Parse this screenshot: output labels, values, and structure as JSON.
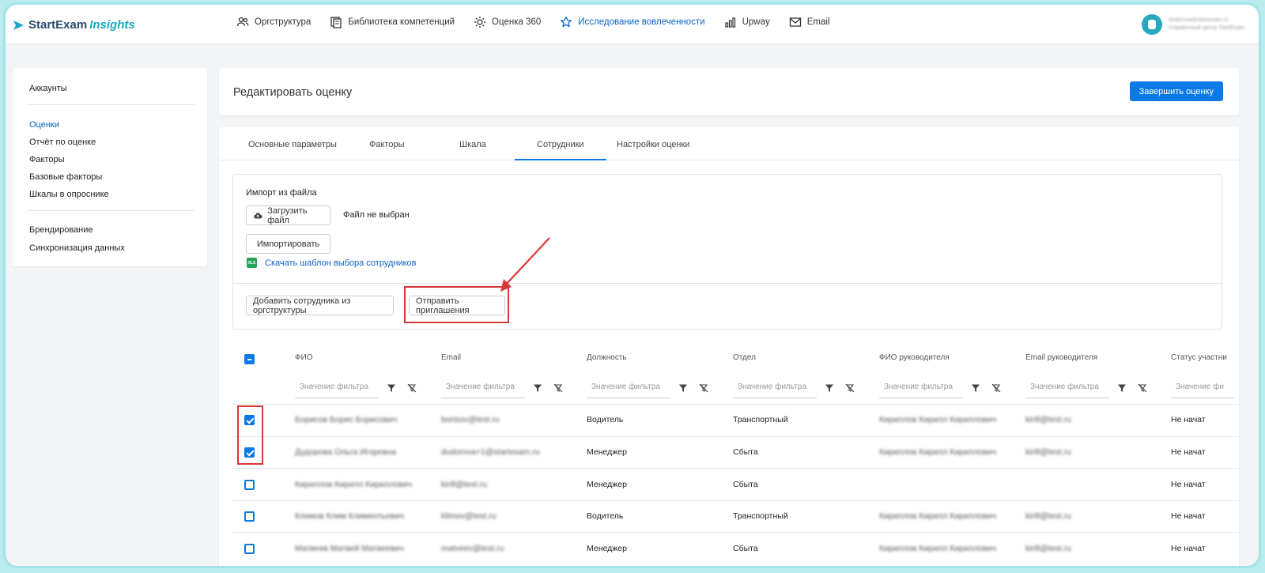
{
  "brand": {
    "part1": "StartExam",
    "part2": "Insights"
  },
  "nav": {
    "items": [
      {
        "label": "Оргструктура",
        "icon": "people-icon"
      },
      {
        "label": "Библиотека компетенций",
        "icon": "library-icon"
      },
      {
        "label": "Оценка 360",
        "icon": "settings-sun-icon"
      },
      {
        "label": "Исследование вовлеченности",
        "icon": "star-icon",
        "active": true
      },
      {
        "label": "Upway",
        "icon": "bar-chart-icon"
      },
      {
        "label": "Email",
        "icon": "mail-icon"
      }
    ]
  },
  "user": {
    "email": "dudorova@startexam.ru",
    "org": "Справочный центр StartExam"
  },
  "sidebar": {
    "items": [
      {
        "label": "Аккаунты"
      },
      {
        "label": "Оценки",
        "active": true
      },
      {
        "label": "Отчёт по оценке"
      },
      {
        "label": "Факторы"
      },
      {
        "label": "Базовые факторы"
      },
      {
        "label": "Шкалы в опроснике"
      },
      {
        "label": "Брендирование"
      },
      {
        "label": "Синхронизация данных"
      }
    ]
  },
  "header": {
    "title": "Редактировать оценку",
    "finish_label": "Завершить оценку"
  },
  "tabs": [
    {
      "label": "Основные параметры"
    },
    {
      "label": "Факторы"
    },
    {
      "label": "Шкала"
    },
    {
      "label": "Сотрудники",
      "active": true
    },
    {
      "label": "Настройки оценки"
    }
  ],
  "import": {
    "heading": "Импорт из файла",
    "upload_label": "Загрузить файл",
    "no_file": "Файл не выбран",
    "import_label": "Импортировать",
    "xls_badge": "XLS",
    "template_link": "Скачать шаблон выбора сотрудников",
    "add_from_org_label": "Добавить сотрудника из оргструктуры",
    "send_invites_label": "Отправить приглашения"
  },
  "table": {
    "columns": [
      "ФИО",
      "Email",
      "Должность",
      "Отдел",
      "ФИО руководителя",
      "Email руководителя",
      "Статус участни"
    ],
    "filter_placeholder": "Значение фильтра",
    "filter_placeholder_last": "Значение фи",
    "rows": [
      {
        "checked": true,
        "name": "Борисов Борис Борисович",
        "email": "borisov@test.ru",
        "position": "Водитель",
        "dept": "Транспортный",
        "manager": "Кириллов Кирилл Кириллович",
        "manager_email": "kirill@test.ru",
        "status": "Не начат"
      },
      {
        "checked": true,
        "name": "Дудорова Ольга Игоревна",
        "email": "dudorova+1@startexam.ru",
        "position": "Менеджер",
        "dept": "Сбыта",
        "manager": "Кириллов Кирилл Кириллович",
        "manager_email": "kirill@test.ru",
        "status": "Не начат"
      },
      {
        "checked": false,
        "name": "Кириллов Кирилл Кириллович",
        "email": "kirill@test.ru",
        "position": "Менеджер",
        "dept": "Сбыта",
        "manager": "",
        "manager_email": "",
        "status": "Не начат"
      },
      {
        "checked": false,
        "name": "Климов Клим Климентьевич",
        "email": "klimov@test.ru",
        "position": "Водитель",
        "dept": "Транспортный",
        "manager": "Кириллов Кирилл Кириллович",
        "manager_email": "kirill@test.ru",
        "status": "Не начат"
      },
      {
        "checked": false,
        "name": "Матвеев Матвей Матвеевич",
        "email": "matveev@test.ru",
        "position": "Менеджер",
        "dept": "Сбыта",
        "manager": "Кириллов Кирилл Кириллович",
        "manager_email": "kirill@test.ru",
        "status": "Не начат"
      }
    ]
  },
  "colors": {
    "accent": "#0b7ae6",
    "highlight": "#d93838",
    "brand_teal": "#18a7c6"
  }
}
